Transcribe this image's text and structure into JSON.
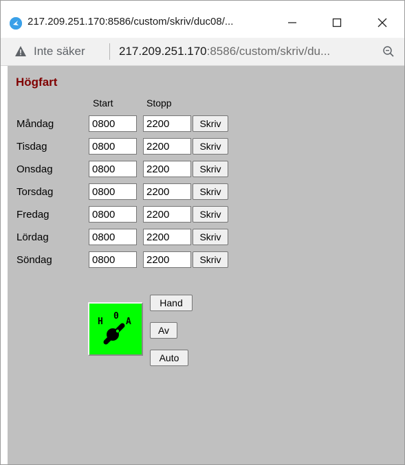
{
  "window": {
    "title": "217.209.251.170:8586/custom/skriv/duc08/...",
    "controls": {
      "minimize": "minimize-icon",
      "maximize": "maximize-icon",
      "close": "close-icon"
    }
  },
  "addressbar": {
    "security_label": "Inte säker",
    "url_host": "217.209.251.170",
    "url_rest": ":8586/custom/skriv/du...",
    "icons": [
      "warning-icon",
      "zoom-out-icon"
    ]
  },
  "page": {
    "title": "Högfart",
    "columns": {
      "start": "Start",
      "stopp": "Stopp"
    },
    "days": [
      {
        "label": "Måndag",
        "start": "0800",
        "stopp": "2200",
        "button": "Skriv"
      },
      {
        "label": "Tisdag",
        "start": "0800",
        "stopp": "2200",
        "button": "Skriv"
      },
      {
        "label": "Onsdag",
        "start": "0800",
        "stopp": "2200",
        "button": "Skriv"
      },
      {
        "label": "Torsdag",
        "start": "0800",
        "stopp": "2200",
        "button": "Skriv"
      },
      {
        "label": "Fredag",
        "start": "0800",
        "stopp": "2200",
        "button": "Skriv"
      },
      {
        "label": "Lördag",
        "start": "0800",
        "stopp": "2200",
        "button": "Skriv"
      },
      {
        "label": "Söndag",
        "start": "0800",
        "stopp": "2200",
        "button": "Skriv"
      }
    ],
    "switch": {
      "labels": {
        "hand": "H",
        "off": "0",
        "auto": "A"
      },
      "indicator_color": "#00ff00"
    },
    "mode_buttons": {
      "hand": "Hand",
      "off": "Av",
      "auto": "Auto"
    }
  },
  "colors": {
    "title": "#800000",
    "content_background": "#c0c0c0",
    "favicon": "#3aa0e8"
  }
}
